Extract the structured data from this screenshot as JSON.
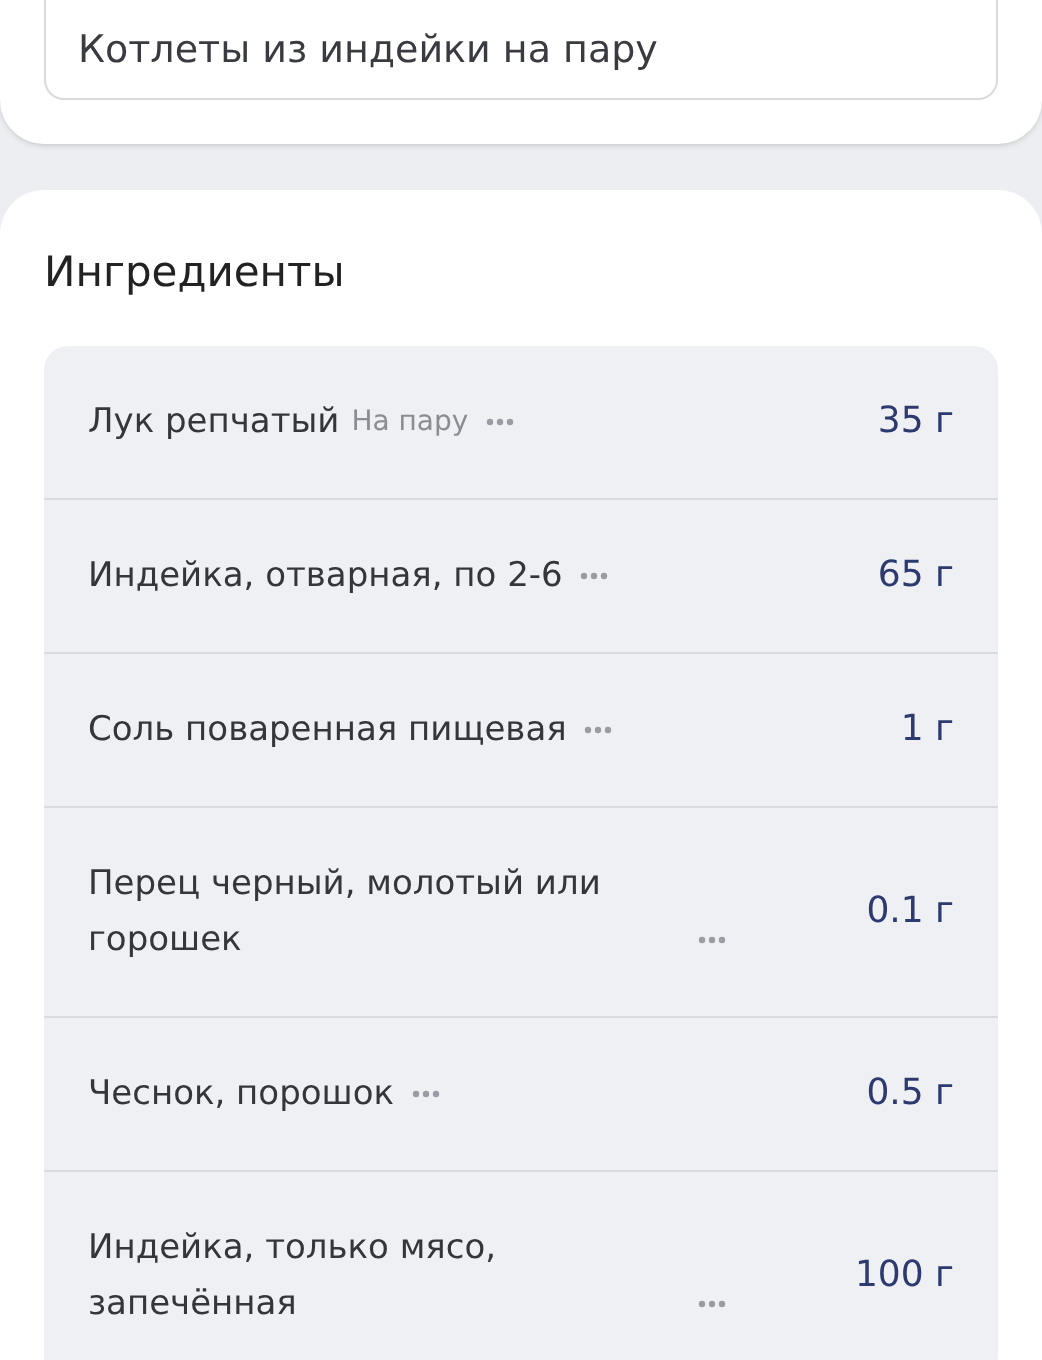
{
  "recipe_name_field": {
    "value": "Котлеты из индейки на пару"
  },
  "ingredients": {
    "title": "Ингредиенты",
    "items": [
      {
        "name": "Лук репчатый",
        "note": "На пару",
        "amount": "35 г"
      },
      {
        "name": "Индейка, отварная, по 2-6",
        "amount": "65 г"
      },
      {
        "name": "Соль поваренная пищевая",
        "amount": "1 г"
      },
      {
        "name": "Перец черный, молотый или горошек",
        "amount": "0.1 г"
      },
      {
        "name": "Чеснок, порошок",
        "amount": "0.5 г"
      },
      {
        "name": "Индейка, только мясо, запечённая",
        "amount": "100 г"
      }
    ]
  }
}
